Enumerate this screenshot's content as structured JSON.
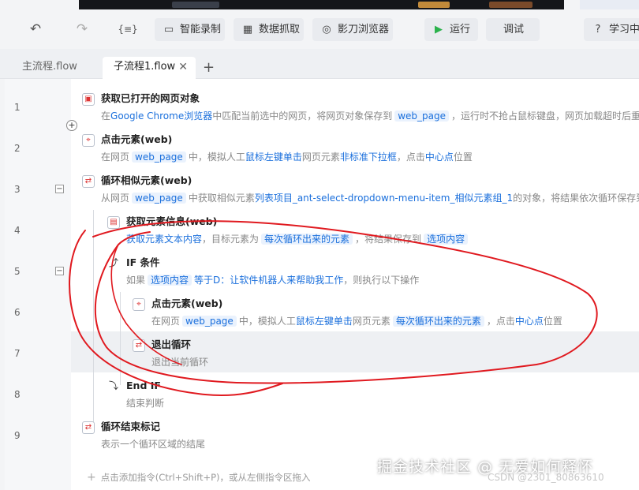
{
  "toolbar": {
    "buttons": [
      {
        "label": "智能录制",
        "icon": "video-icon"
      },
      {
        "label": "数据抓取",
        "icon": "table-icon"
      },
      {
        "label": "影刀浏览器",
        "icon": "browser-icon"
      },
      {
        "label": "运行",
        "icon": "play-icon"
      },
      {
        "label": "调试",
        "icon": ""
      },
      {
        "label": "学习中",
        "icon": "help-icon"
      }
    ],
    "variable_icon_text": "{≡}"
  },
  "tabs": [
    {
      "label": "主流程.flow"
    },
    {
      "label": "子流程1.flow"
    }
  ],
  "lines": [
    "1",
    "2",
    "3",
    "4",
    "5",
    "6",
    "7",
    "8",
    "9"
  ],
  "steps": {
    "s1": {
      "title": "获取已打开的网页对象",
      "d1": "在",
      "d2": "Google Chrome浏览器",
      "d3": "中匹配当前选中的网页，将网页对象保存到",
      "d4": "web_page",
      "d5": "，运行时不抢占鼠标键盘，网页加载超时后重"
    },
    "s2": {
      "title": "点击元素(web)",
      "d1": "在网页",
      "d2": "web_page",
      "d3": "中，模拟人工",
      "d4": "鼠标左键单击",
      "d5": "网页元素",
      "d6": "非标准下拉框",
      "d7": "，点击",
      "d8": "中心点",
      "d9": "位置"
    },
    "s3": {
      "title": "循环相似元素(web)",
      "d1": "从网页",
      "d2": "web_page",
      "d3": "中获取相似元素",
      "d4": "列表项目_ant-select-dropdown-menu-item_相似元素组_1",
      "d5": "的对象，将结果依次循环保存到"
    },
    "s4": {
      "title": "获取元素信息(web)",
      "d1": "获取元素文本内容",
      "d2": "，目标元素为",
      "d3": "每次循环出来的元素",
      "d4": "，将结果保存到",
      "d5": "选项内容"
    },
    "s5": {
      "title": "IF 条件",
      "d1": "如果",
      "d2": "选项内容",
      "d3": "等于",
      "d4": "D：让软件机器人来帮助我工作",
      "d5": "，则执行以下操作"
    },
    "s6": {
      "title": "点击元素(web)",
      "d1": "在网页",
      "d2": "web_page",
      "d3": "中，模拟人工",
      "d4": "鼠标左键单击",
      "d5": "网页元素",
      "d6": "每次循环出来的元素",
      "d7": "，点击",
      "d8": "中心点",
      "d9": "位置"
    },
    "s7": {
      "title": "退出循环",
      "desc": "退出当前循环"
    },
    "s8": {
      "title": "End IF",
      "desc": "结束判断"
    },
    "s9": {
      "title": "循环结束标记",
      "desc": "表示一个循环区域的结尾"
    }
  },
  "add_hint": "点击添加指令(Ctrl+Shift+P)，或从左侧指令区拖入",
  "watermark": {
    "main": "掘金技术社区 @ 无爱如何释怀",
    "sub": "CSDN @2301_80863610"
  },
  "colors": {
    "link": "#1a6fdc",
    "annotation": "#e0191f",
    "run_icon": "#2bb24c"
  }
}
